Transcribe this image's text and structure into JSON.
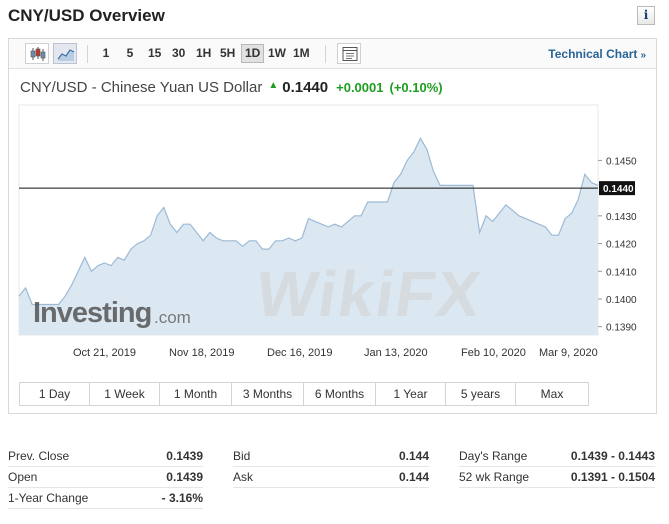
{
  "page": {
    "title": "CNY/USD Overview",
    "info_label": "i"
  },
  "toolbar": {
    "icons": [
      "candlestick-icon",
      "area-chart-icon",
      "settings-panel-icon"
    ],
    "intervals": [
      "1",
      "5",
      "15",
      "30",
      "1H",
      "5H",
      "1D",
      "1W",
      "1M"
    ],
    "active_interval": "1D",
    "technical_chart_label": "Technical Chart",
    "technical_chart_arrow": "»"
  },
  "quote": {
    "name": "CNY/USD - Chinese Yuan US Dollar",
    "direction_glyph": "▲",
    "price": "0.1440",
    "change": "+0.0001",
    "change_pct": "(+0.10%)"
  },
  "watermark": {
    "brand": "Investing",
    "suffix": ".com",
    "overlay": "WikiFX"
  },
  "chart_data": {
    "type": "area",
    "x_tick_labels": [
      "Oct 21, 2019",
      "Nov 18, 2019",
      "Dec 16, 2019",
      "Jan 13, 2020",
      "Feb 10, 2020",
      "Mar 9, 2020"
    ],
    "y_tick_labels": [
      "0.1450",
      "0.1440",
      "0.1430",
      "0.1420",
      "0.1410",
      "0.1400",
      "0.1390"
    ],
    "ylim": [
      0.1387,
      0.147
    ],
    "current_price_label": "0.1440",
    "current_price": 0.144,
    "values": [
      0.1401,
      0.1404,
      0.1398,
      0.1398,
      0.1398,
      0.1398,
      0.1398,
      0.1401,
      0.1405,
      0.141,
      0.1415,
      0.141,
      0.1412,
      0.1413,
      0.1412,
      0.1415,
      0.1414,
      0.1418,
      0.142,
      0.1421,
      0.1423,
      0.143,
      0.1433,
      0.1427,
      0.1424,
      0.1427,
      0.1427,
      0.1424,
      0.1421,
      0.1424,
      0.1422,
      0.1421,
      0.1421,
      0.1421,
      0.1419,
      0.1421,
      0.1421,
      0.1418,
      0.1418,
      0.1421,
      0.1421,
      0.1422,
      0.1421,
      0.1422,
      0.1429,
      0.1428,
      0.1427,
      0.1426,
      0.1427,
      0.1426,
      0.1428,
      0.143,
      0.143,
      0.1435,
      0.1435,
      0.1435,
      0.1435,
      0.1442,
      0.1445,
      0.145,
      0.1453,
      0.1458,
      0.1454,
      0.1446,
      0.1441,
      0.1441,
      0.1441,
      0.1441,
      0.1441,
      0.1441,
      0.1424,
      0.143,
      0.1428,
      0.1431,
      0.1434,
      0.1432,
      0.143,
      0.1429,
      0.1428,
      0.1427,
      0.1426,
      0.1423,
      0.1423,
      0.1429,
      0.1431,
      0.1436,
      0.1445,
      0.1442,
      0.1441
    ]
  },
  "range_buttons": [
    "1 Day",
    "1 Week",
    "1 Month",
    "3 Months",
    "6 Months",
    "1 Year",
    "5 years",
    "Max"
  ],
  "stats": {
    "col1": [
      {
        "label": "Prev. Close",
        "value": "0.1439"
      },
      {
        "label": "Open",
        "value": "0.1439"
      },
      {
        "label": "1-Year Change",
        "value": "- 3.16%"
      }
    ],
    "col2": [
      {
        "label": "Bid",
        "value": "0.144"
      },
      {
        "label": "Ask",
        "value": "0.144"
      }
    ],
    "col3": [
      {
        "label": "Day's Range",
        "value": "0.1439 - 0.1443"
      },
      {
        "label": "52 wk Range",
        "value": "0.1391 - 0.1504"
      }
    ]
  },
  "colors": {
    "area_fill": "#dbe7f1",
    "area_line": "#9cbad6",
    "price_line": "#111111",
    "price_label_bg": "#111111",
    "positive": "#1e9e1e",
    "link": "#2a6496"
  }
}
